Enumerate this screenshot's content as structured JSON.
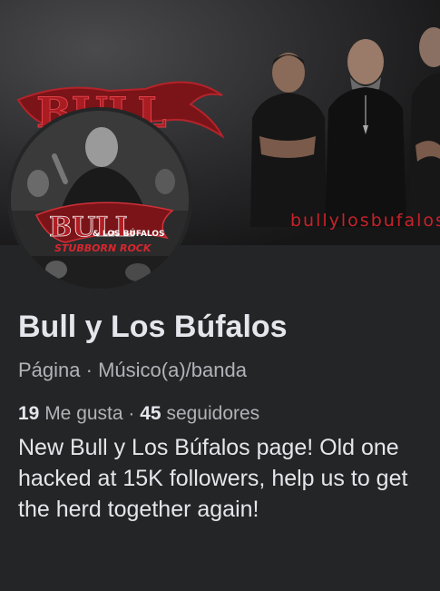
{
  "cover": {
    "logo_text": "BULL",
    "watermark": "bullylosbufalos"
  },
  "avatar": {
    "logo_text": "BULL",
    "sub_text": "& LOS BÚFALOS",
    "tagline": "STUBBORN ROCK"
  },
  "page": {
    "name": "Bull y Los Búfalos",
    "type": "Página",
    "separator": " · ",
    "category": "Músico(a)/banda",
    "likes_count": "19",
    "likes_label": " Me gusta",
    "followers_count": "45",
    "followers_label": " seguidores",
    "bio": "New Bull y Los Búfalos page! Old one hacked at 15K followers, help us to get the herd together again!"
  },
  "colors": {
    "background": "#242526",
    "text_primary": "#e4e6eb",
    "text_secondary": "#b0b3b8",
    "brand_red": "#c7222a"
  }
}
